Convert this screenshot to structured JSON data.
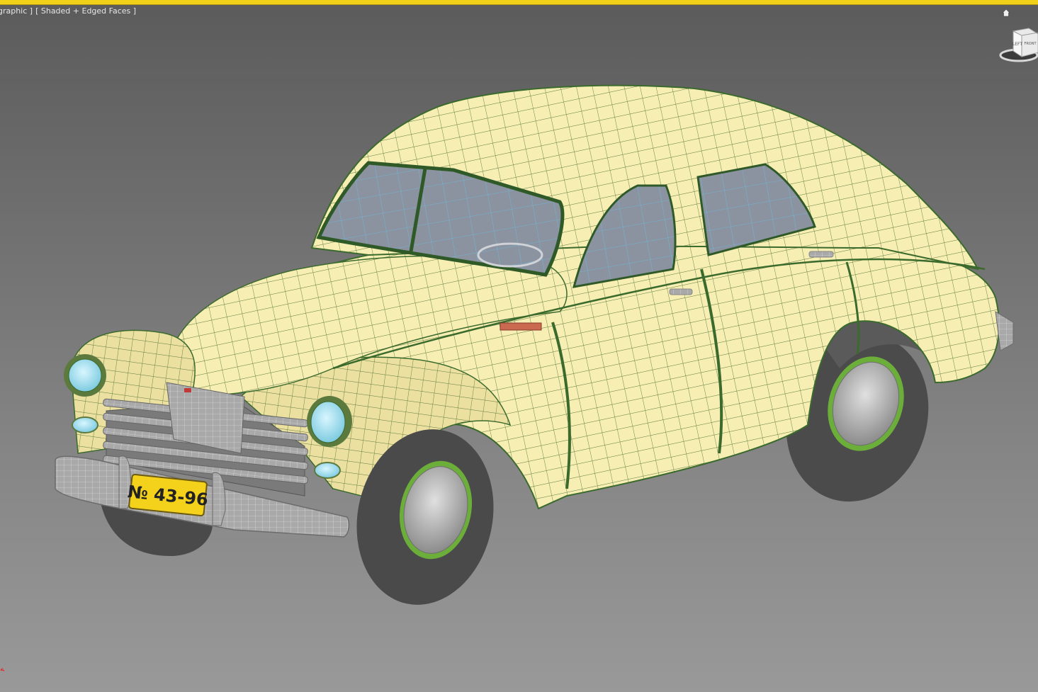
{
  "viewport": {
    "label_view": "[ Orthographic ]",
    "label_shading": "[ Shaded + Edged Faces ]",
    "active_border_color": "#f0d018"
  },
  "viewcube": {
    "face_left": "LEFT",
    "face_front": "FRONT"
  },
  "model": {
    "license_plate": "№ 43-96",
    "body_color": "#f7eeb3",
    "wire_color": "#3b6a2d",
    "chrome_color": "#a8a8a8"
  },
  "icons": {
    "home": "home-icon",
    "viewcube": "viewcube-icon",
    "axis": "axis-tripod-icon"
  }
}
